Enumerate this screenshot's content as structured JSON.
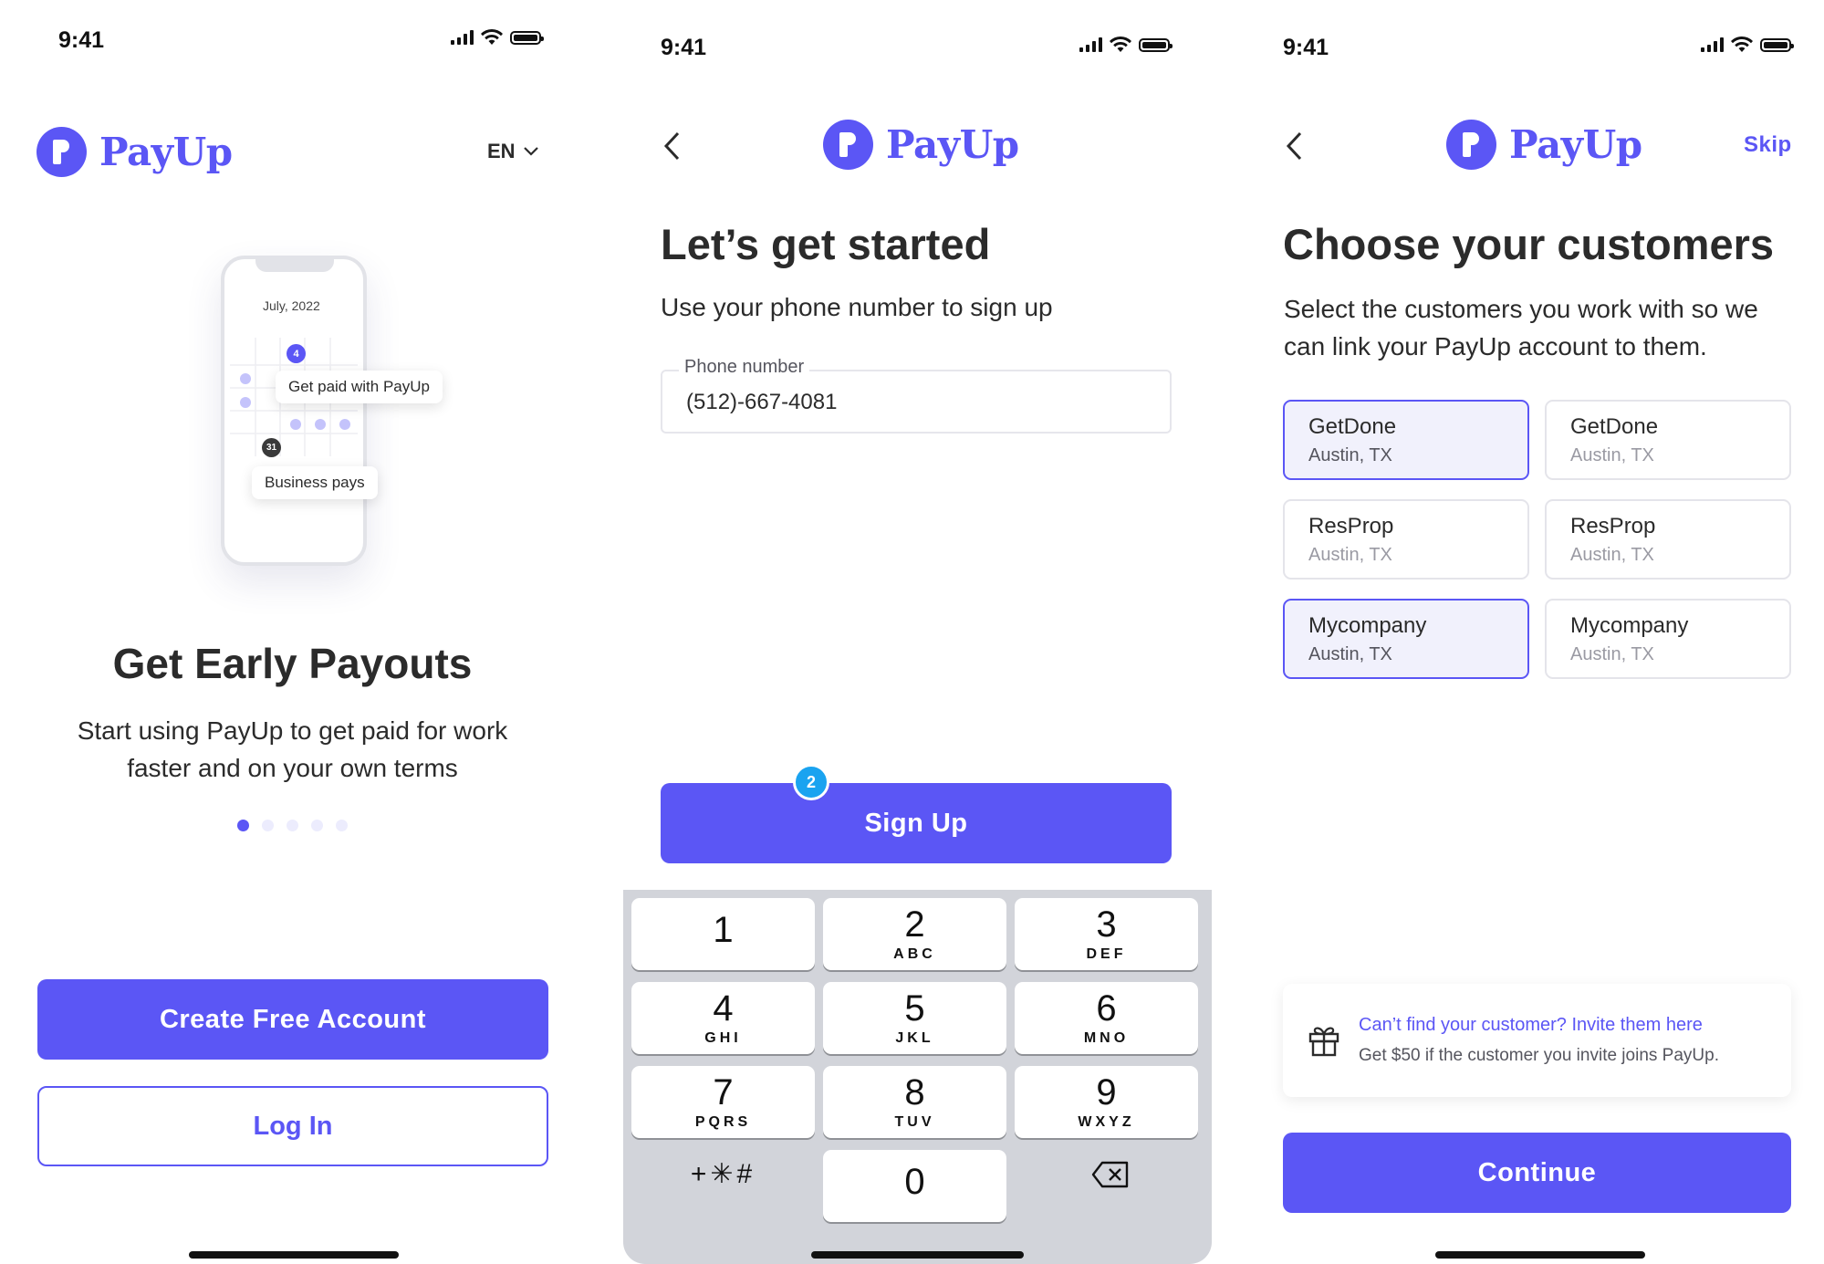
{
  "brand": {
    "name": "PayUp",
    "color": "#5b56f5"
  },
  "status_bar": {
    "time": "9:41"
  },
  "screen1": {
    "language": "EN",
    "illustration": {
      "date": "July, 2022",
      "badge_top": "4",
      "badge_bottom": "31",
      "tooltip_paid": "Get paid with PayUp",
      "tooltip_business": "Business pays"
    },
    "title": "Get Early Payouts",
    "subtitle_line1": "Start using PayUp to get paid for work",
    "subtitle_line2": "faster and on your own terms",
    "pager": {
      "count": 5,
      "active": 0
    },
    "create_account_label": "Create Free Account",
    "login_label": "Log In"
  },
  "screen2": {
    "title": "Let’s get started",
    "subtitle": "Use your phone number to sign up",
    "phone_field": {
      "label": "Phone number",
      "value": "(512)-667-4081"
    },
    "step_badge": "2",
    "signup_label": "Sign Up",
    "keypad": [
      {
        "num": "1",
        "letters": ""
      },
      {
        "num": "2",
        "letters": "ABC"
      },
      {
        "num": "3",
        "letters": "DEF"
      },
      {
        "num": "4",
        "letters": "GHI"
      },
      {
        "num": "5",
        "letters": "JKL"
      },
      {
        "num": "6",
        "letters": "MNO"
      },
      {
        "num": "7",
        "letters": "PQRS"
      },
      {
        "num": "8",
        "letters": "TUV"
      },
      {
        "num": "9",
        "letters": "WXYZ"
      },
      {
        "num": "0",
        "letters": ""
      }
    ],
    "symbols_key": "+✳#"
  },
  "screen3": {
    "skip_label": "Skip",
    "title": "Choose your customers",
    "subtitle_line1": "Select the customers you work with so we",
    "subtitle_line2": "can link your PayUp account to them.",
    "customers": [
      {
        "name": "GetDone",
        "location": "Austin, TX",
        "selected": true
      },
      {
        "name": "GetDone",
        "location": "Austin, TX",
        "selected": false
      },
      {
        "name": "ResProp",
        "location": "Austin, TX",
        "selected": false
      },
      {
        "name": "ResProp",
        "location": "Austin, TX",
        "selected": false
      },
      {
        "name": "Mycompany",
        "location": "Austin, TX",
        "selected": true
      },
      {
        "name": "Mycompany",
        "location": "Austin, TX",
        "selected": false
      }
    ],
    "invite": {
      "link": "Can’t find your customer? Invite them here",
      "note": "Get $50 if the customer you invite joins PayUp."
    },
    "continue_label": "Continue"
  }
}
